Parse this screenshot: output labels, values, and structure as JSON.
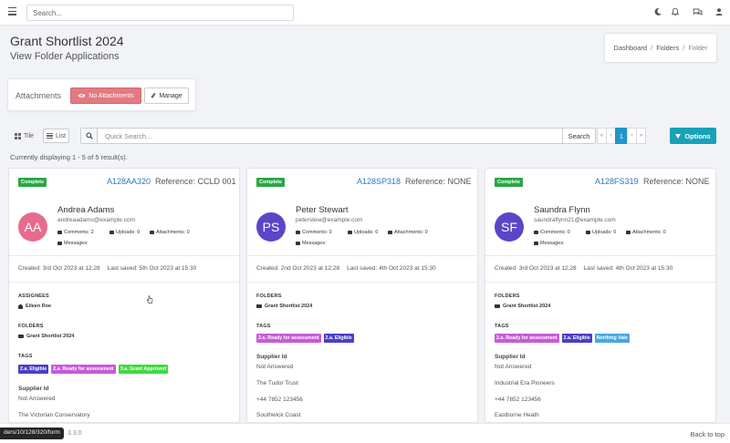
{
  "topbar": {
    "search_placeholder": "Search...",
    "icons": [
      "hamburger-icon",
      "moon-icon",
      "bell-icon",
      "chat-icon",
      "user-icon"
    ]
  },
  "header": {
    "title": "Grant Shortlist 2024",
    "subtitle": "View Folder Applications",
    "breadcrumb": [
      "Dashboard",
      "Folders",
      "Folder"
    ]
  },
  "attachments": {
    "label": "Attachments",
    "no_attachments_label": "No Attachments",
    "manage_label": "Manage"
  },
  "toolbar": {
    "tile_label": "Tile",
    "list_label": "List",
    "quick_search_placeholder": "Quick Search...",
    "search_label": "Search",
    "pager": {
      "first": "«",
      "prev": "‹",
      "current": "1",
      "next": "›",
      "last": "»"
    },
    "options_label": "Options"
  },
  "result_count": "Currently displaying 1 - 5 of 5 result(s).",
  "cards": [
    {
      "status": "Complete",
      "app_id": "A128AA320",
      "reference": "Reference: CCLD 001",
      "initials": "AA",
      "avatar_color": "#e86b8d",
      "name": "Andrea Adams",
      "email": "andreaadams@example.com",
      "comments": "Comments: 2",
      "uploads": "Uploads: 0",
      "attachments": "Attachments: 0",
      "messages": "Messages:",
      "created": "Created: 3rd Oct 2023 at 12:28",
      "saved": "Last saved: 5th Oct 2023 at 15:30",
      "assignees_head": "ASSIGNEES",
      "assignee": "Eileen Roe",
      "folders_head": "FOLDERS",
      "folder": "Grant Shortlist 2024",
      "tags_head": "TAGS",
      "tags": [
        {
          "label": "2.a. Eligible",
          "color": "#4b3fc4"
        },
        {
          "label": "2.a. Ready for assessment",
          "color": "#c85ad8"
        },
        {
          "label": "3.a. Grant Approved",
          "color": "#3ed93e"
        }
      ],
      "supplier_label": "Supplier Id",
      "supplier_value": "Not Answered",
      "org": "The Victorian Conservatory"
    },
    {
      "status": "Complete",
      "app_id": "A128SP318",
      "reference": "Reference: NONE",
      "initials": "PS",
      "avatar_color": "#5b46c9",
      "name": "Peter Stewart",
      "email": "peterstew@example.com",
      "comments": "Comments: 0",
      "uploads": "Uploads: 0",
      "attachments": "Attachments: 0",
      "messages": "Messages:",
      "created": "Created: 2nd Oct 2023 at 12:28",
      "saved": "Last saved: 4th Oct 2023 at 15:30",
      "folders_head": "FOLDERS",
      "folder": "Grant Shortlist 2024",
      "tags_head": "TAGS",
      "tags": [
        {
          "label": "2.a. Ready for assessment",
          "color": "#c85ad8"
        },
        {
          "label": "2.a. Eligible",
          "color": "#4b3fc4"
        }
      ],
      "supplier_label": "Supplier Id",
      "supplier_value": "Not Answered",
      "org": "The Tudor Trust",
      "phone": "+44 7852 123456",
      "address": "Southwick Coast"
    },
    {
      "status": "Complete",
      "app_id": "A128FS319",
      "reference": "Reference: NONE",
      "initials": "SF",
      "avatar_color": "#5b46c9",
      "name": "Saundra Flynn",
      "email": "saundraflynn21@example.com",
      "comments": "Comments: 0",
      "uploads": "Uploads: 0",
      "attachments": "Attachments: 0",
      "messages": "Messages:",
      "created": "Created: 3rd Oct 2023 at 12:28",
      "saved": "Last saved: 4th Oct 2023 at 15:30",
      "folders_head": "FOLDERS",
      "folder": "Grant Shortlist 2024",
      "tags_head": "TAGS",
      "tags": [
        {
          "label": "2.a. Ready for assessment",
          "color": "#c85ad8"
        },
        {
          "label": "2.a. Eligible",
          "color": "#4b3fc4"
        },
        {
          "label": "Northing Vale",
          "color": "#4aa8e0"
        }
      ],
      "supplier_label": "Supplier Id",
      "supplier_value": "Not Answered",
      "org": "Industrial Era Pioneers",
      "phone": "+44 7852 123456",
      "address": "Eastborne Heath"
    }
  ],
  "footer": {
    "url_fragment": "ders/10/128/320/form",
    "version": "3.3.0",
    "back_to_top": "Back to top"
  }
}
